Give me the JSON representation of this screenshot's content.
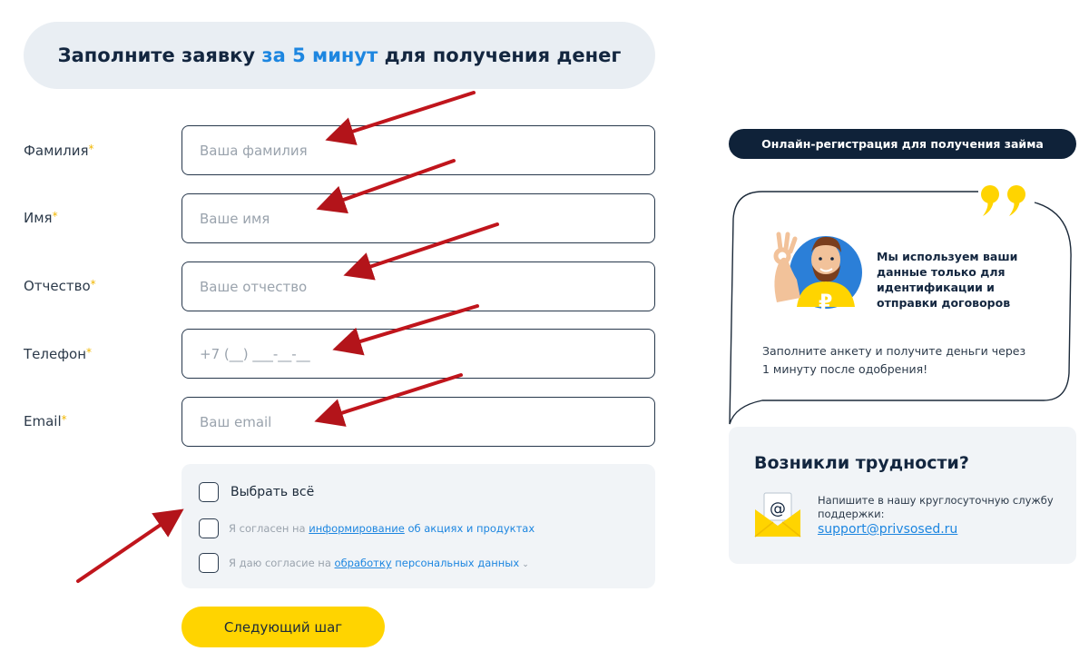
{
  "header": {
    "title_before": "Заполните заявку ",
    "title_accent": "за 5 минут",
    "title_after": " для получения денег"
  },
  "form": {
    "required_mark": "*",
    "fields": [
      {
        "label": "Фамилия",
        "placeholder": "Ваша фамилия"
      },
      {
        "label": "Имя",
        "placeholder": "Ваше имя"
      },
      {
        "label": "Отчество",
        "placeholder": "Ваше отчество"
      },
      {
        "label": "Телефон",
        "placeholder": "+7 (__) ___-__-__"
      },
      {
        "label": "Email",
        "placeholder": "Ваш email"
      }
    ],
    "select_all_label": "Выбрать всё",
    "consent1": {
      "before": "Я согласен на ",
      "link": "информирование",
      "after": " об акциях и продуктах"
    },
    "consent2": {
      "before": "Я даю согласие на ",
      "link": "обработку",
      "after": " персональных данных"
    },
    "next_button": "Следующий шаг"
  },
  "sidebar": {
    "registration_label": "Онлайн-регистрация для получения займа",
    "bubble_title": "Мы используем ваши данные только для идентификации и отправки договоров",
    "bubble_text": "Заполните анкету и получите деньги через 1 минуту после одобрения!",
    "mascot_icon": "ruble-mascot-icon",
    "quote_icon": "quote-icon",
    "help": {
      "title": "Возникли трудности?",
      "text": "Напишите в нашу круглосуточную службу поддержки:",
      "email": "support@privsosed.ru",
      "icon": "mail-icon"
    }
  },
  "colors": {
    "accent_blue": "#1d86e0",
    "button_yellow": "#ffd400",
    "dark_navy": "#0f2239",
    "arrow_red": "#c0151c"
  }
}
